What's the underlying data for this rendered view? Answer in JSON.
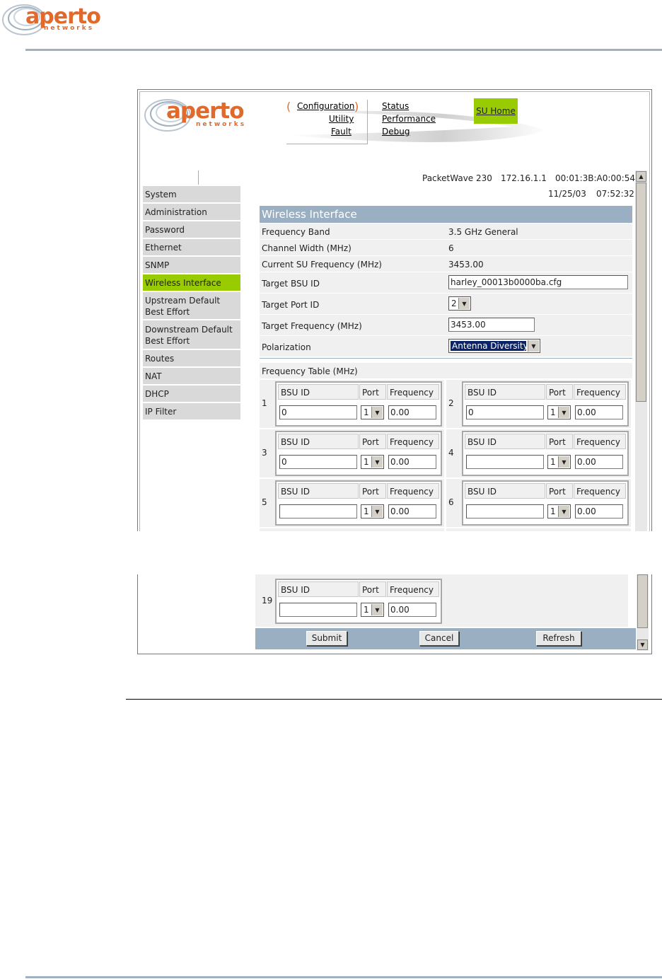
{
  "doc": {
    "logo_word": "aperto",
    "logo_sub": "networks"
  },
  "app": {
    "logo_word": "aperto",
    "logo_sub": "networks",
    "nav_left": [
      "Configuration",
      "Utility",
      "Fault"
    ],
    "nav_right": [
      "Status",
      "Performance",
      "Debug"
    ],
    "su_home": "SU Home",
    "device": "PacketWave 230",
    "ip": "172.16.1.1",
    "mac": "00:01:3B:A0:00:54",
    "date": "11/25/03",
    "time": "07:52:32"
  },
  "sidebar": {
    "items": [
      "System",
      "Administration",
      "Password",
      "Ethernet",
      "SNMP",
      "Wireless Interface",
      "Upstream Default Best Effort",
      "Downstream Default Best Effort",
      "Routes",
      "NAT",
      "DHCP",
      "IP Filter"
    ],
    "active_index": 5
  },
  "page": {
    "title": "Wireless Interface",
    "frequency_band_label": "Frequency Band",
    "frequency_band_value": "3.5 GHz General",
    "channel_width_label": "Channel Width (MHz)",
    "channel_width_value": "6",
    "current_freq_label": "Current SU Frequency (MHz)",
    "current_freq_value": "3453.00",
    "target_bsu_label": "Target BSU ID",
    "target_bsu_value": "harley_00013b0000ba.cfg",
    "target_port_label": "Target Port ID",
    "target_port_value": "2",
    "target_freq_label": "Target Frequency (MHz)",
    "target_freq_value": "3453.00",
    "polarization_label": "Polarization",
    "polarization_value": "Antenna Diversity",
    "freq_table_label": "Frequency Table (MHz)"
  },
  "freq_table": {
    "col_bsu": "BSU ID",
    "col_port": "Port",
    "col_freq": "Frequency",
    "entries": [
      {
        "num": "1",
        "bsu": "0",
        "port": "1",
        "freq": "0.00"
      },
      {
        "num": "2",
        "bsu": "0",
        "port": "1",
        "freq": "0.00"
      },
      {
        "num": "3",
        "bsu": "0",
        "port": "1",
        "freq": "0.00"
      },
      {
        "num": "4",
        "bsu": "",
        "port": "1",
        "freq": "0.00"
      },
      {
        "num": "5",
        "bsu": "",
        "port": "1",
        "freq": "0.00"
      },
      {
        "num": "6",
        "bsu": "",
        "port": "1",
        "freq": "0.00"
      },
      {
        "num": "19",
        "bsu": "",
        "port": "1",
        "freq": "0.00"
      }
    ]
  },
  "buttons": {
    "submit": "Submit",
    "cancel": "Cancel",
    "refresh": "Refresh"
  },
  "colors": {
    "accent_green": "#99cc00",
    "header_blue": "#9ab0c2",
    "brand_orange": "#e06a2c"
  }
}
